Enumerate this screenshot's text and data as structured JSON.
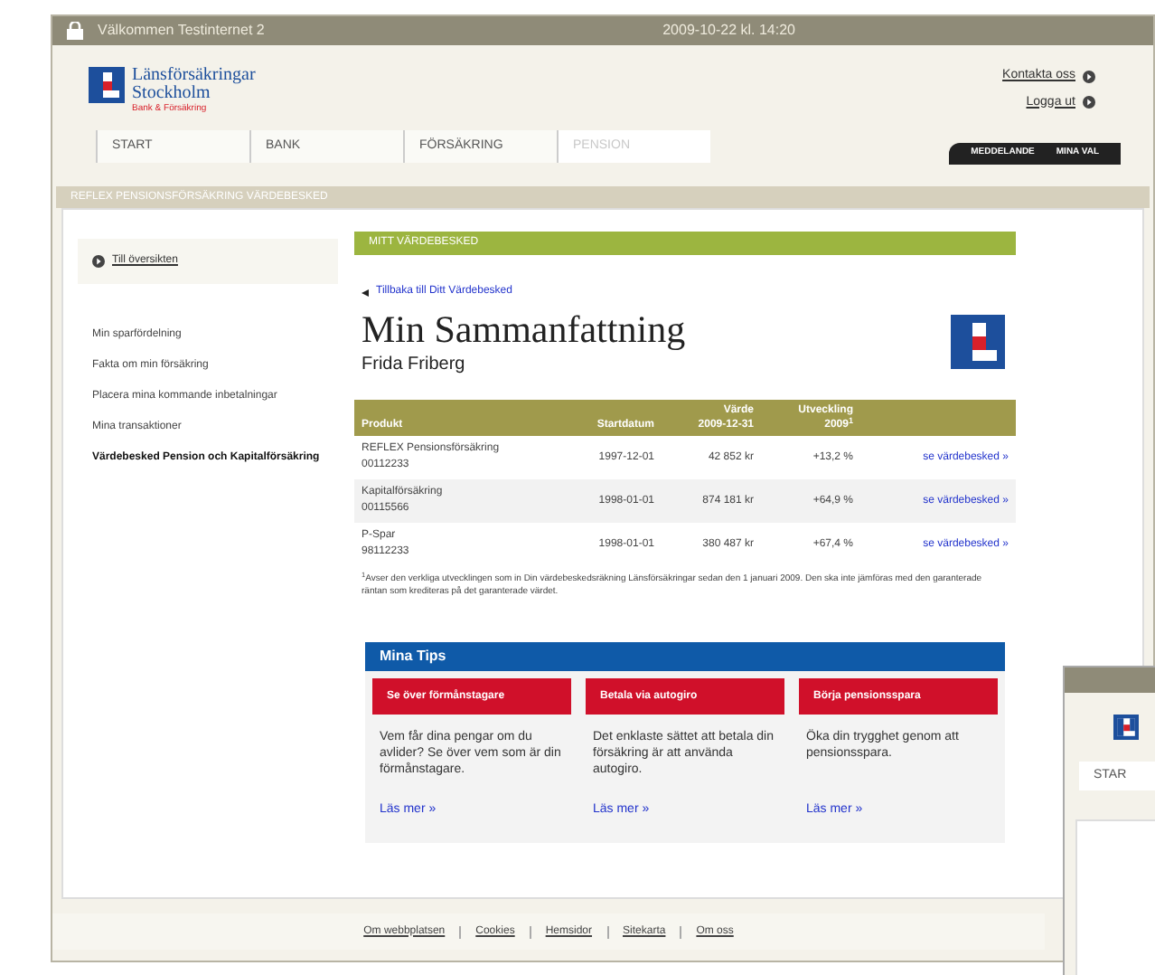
{
  "window": {
    "title": "Välkommen Testinternet 2",
    "datetime": "2009-10-22 kl. 14:20"
  },
  "header": {
    "logo": {
      "line1": "Länsförsäkringar",
      "line2": "Stockholm",
      "tagline": "Bank & Försäkring"
    },
    "top_links": [
      "Kontakta oss",
      "Logga ut"
    ],
    "nav_tabs": [
      {
        "label": "START",
        "selected": false
      },
      {
        "label": "BANK",
        "selected": false
      },
      {
        "label": "FÖRSÄKRING",
        "selected": false
      },
      {
        "label": "PENSION",
        "selected": true
      }
    ],
    "user_tabs": [
      "MEDDELANDE",
      "MINA VAL"
    ]
  },
  "breadcrumb": "REFLEX PENSIONSFÖRSÄKRING VÄRDEBESKED",
  "sidebar": {
    "back_link": "Till översikten",
    "items": [
      {
        "label": "Min sparfördelning",
        "selected": false
      },
      {
        "label": "Fakta om min försäkring",
        "selected": false
      },
      {
        "label": "Placera mina kommande inbetalningar",
        "selected": false
      },
      {
        "label": "Mina transaktioner",
        "selected": false
      },
      {
        "label": "Värdebesked Pension och Kapitalförsäkring",
        "selected": true
      }
    ]
  },
  "content": {
    "section_title": "MITT VÄRDEBESKED",
    "back_link": "Tillbaka till Ditt Värdebesked",
    "heading": "Min Sammanfattning",
    "subheading": "Frida Friberg",
    "table": {
      "columns": [
        {
          "lines": [
            "Produkt"
          ]
        },
        {
          "lines": [
            "Startdatum"
          ]
        },
        {
          "lines": [
            "Värde",
            "2009-12-31"
          ]
        },
        {
          "lines": [
            "Utveckling",
            "2009$^{1}$"
          ]
        }
      ],
      "rows": [
        {
          "product": "REFLEX Pensionsförsäkring",
          "number": "00112233",
          "start": "1997-12-01",
          "value": "42 852 kr",
          "change": "+13,2 %",
          "link": "se värdebesked »"
        },
        {
          "product": "Kapitalförsäkring",
          "number": "00115566",
          "start": "1998-01-01",
          "value": "874 181 kr",
          "change": "+64,9 %",
          "link": "se värdebesked »"
        },
        {
          "product": "P-Spar",
          "number": "98112233",
          "start": "1998-01-01",
          "value": "380 487 kr",
          "change": "+67,4 %",
          "link": "se värdebesked »"
        }
      ]
    },
    "footnote": "$^{1}$Avser den verkliga utvecklingen som in Din värdebeskedsräkning Länsförsäkringar sedan den 1 januari 2009. Den ska inte jämföras med den garanterade räntan som krediteras på det garanterade värdet."
  },
  "tips": {
    "title": "Mina Tips",
    "cards": [
      {
        "title": "Se över förmånstagare",
        "text": "Vem får dina pengar om du avlider? Se över vem som är din förmånstagare.",
        "link": "Läs mer »"
      },
      {
        "title": "Betala via autogiro",
        "text": "Det enklaste sättet att betala din försäkring är att använda autogiro.",
        "link": "Läs mer »"
      },
      {
        "title": "Börja pensionsspara",
        "text": "Öka din trygghet genom att pensionsspara.",
        "link": "Läs mer »"
      }
    ]
  },
  "footer_links": [
    "Om webbplatsen",
    "Cookies",
    "Hemsidor",
    "Sitekarta",
    "Om oss"
  ],
  "background_window": {
    "tab": "STAR"
  }
}
